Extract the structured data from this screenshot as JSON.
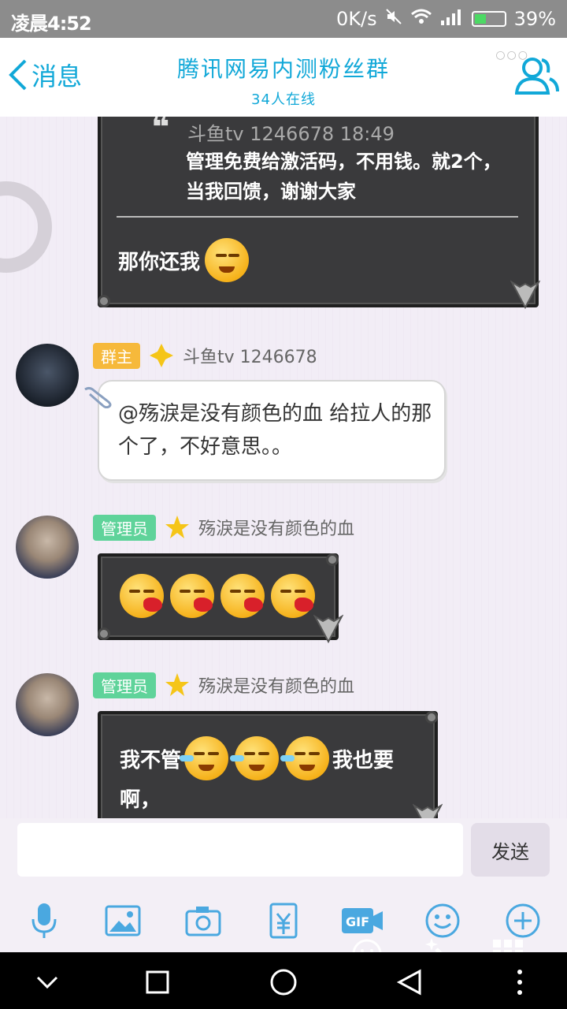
{
  "status_bar": {
    "time": "凌晨4:52",
    "net_speed": "0K/s",
    "battery": "39%",
    "battery_level": 0.39
  },
  "header": {
    "back_label": "消息",
    "title": "腾讯网易内测粉丝群",
    "subtitle": "34人在线"
  },
  "messages": [
    {
      "quote_meta": "斗鱼tv 1246678 18:49",
      "quote_text": "管理免费给激活码，不用钱。就2个，当我回馈，谢谢大家",
      "reply_text": "那你还我"
    },
    {
      "badge": "群主",
      "sender": "斗鱼tv 1246678",
      "text": "@殇淚是没有颜色的血 给拉人的那个了，不好意思。。"
    },
    {
      "badge": "管理员",
      "sender": "殇淚是没有颜色的血"
    },
    {
      "badge": "管理员",
      "sender": "殇淚是没有颜色的血",
      "text_before": "我不管",
      "text_after": "我也要",
      "text_line2": "啊，"
    }
  ],
  "input": {
    "value": "",
    "send_label": "发送"
  },
  "colors": {
    "accent": "#11a8d8",
    "owner_badge": "#f6b93b",
    "admin_badge": "#5fd39a"
  }
}
